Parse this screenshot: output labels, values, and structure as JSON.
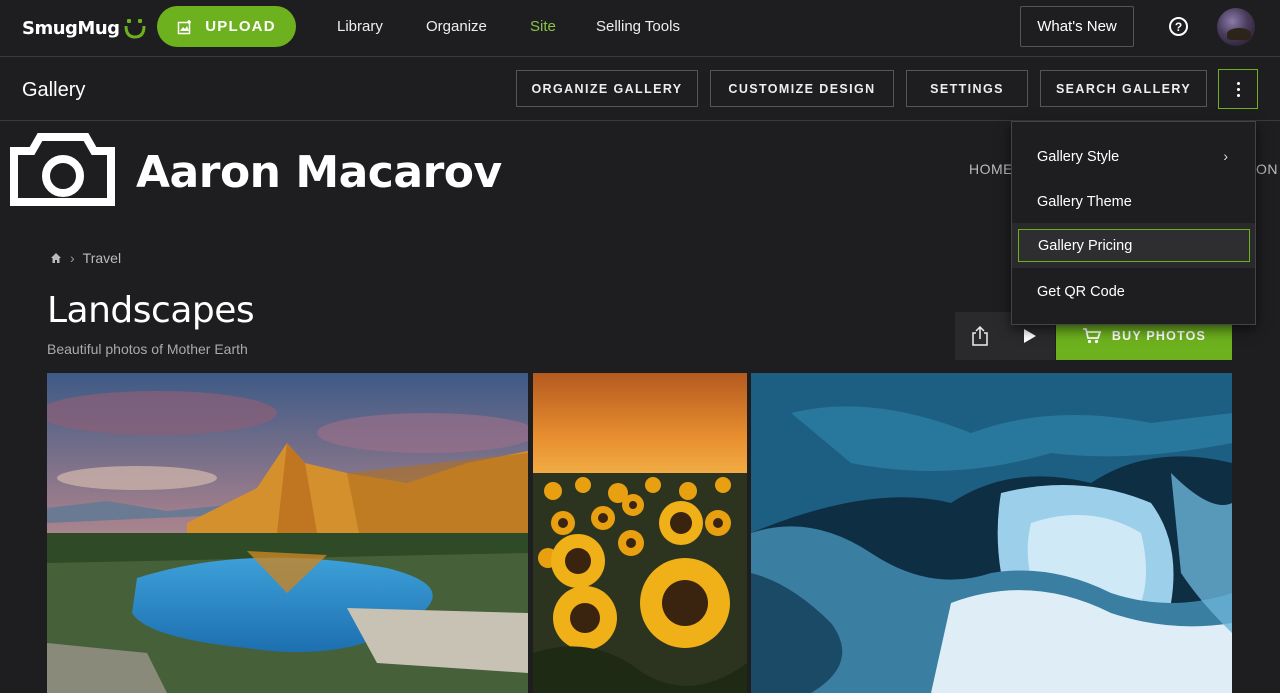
{
  "brand": {
    "name": "SmugMug",
    "accent": "#6db11f"
  },
  "topnav": {
    "upload_label": "UPLOAD",
    "links": [
      "Library",
      "Organize",
      "Site",
      "Selling Tools"
    ],
    "active_link": "Site",
    "whats_new": "What's New",
    "help_icon": "?"
  },
  "toolbar": {
    "title": "Gallery",
    "buttons": [
      "ORGANIZE GALLERY",
      "CUSTOMIZE DESIGN",
      "SETTINGS",
      "SEARCH GALLERY"
    ]
  },
  "site": {
    "name": "Aaron Macarov",
    "nav_home": "HOME",
    "nav_clipped": "ON"
  },
  "breadcrumb": {
    "item": "Travel"
  },
  "gallery": {
    "title": "Landscapes",
    "subtitle": "Beautiful photos of Mother Earth",
    "buy_label": "BUY PHOTOS"
  },
  "menu": {
    "items": [
      "Gallery Style",
      "Gallery Theme",
      "Gallery Pricing",
      "Get QR Code"
    ],
    "highlighted": "Gallery Pricing"
  }
}
